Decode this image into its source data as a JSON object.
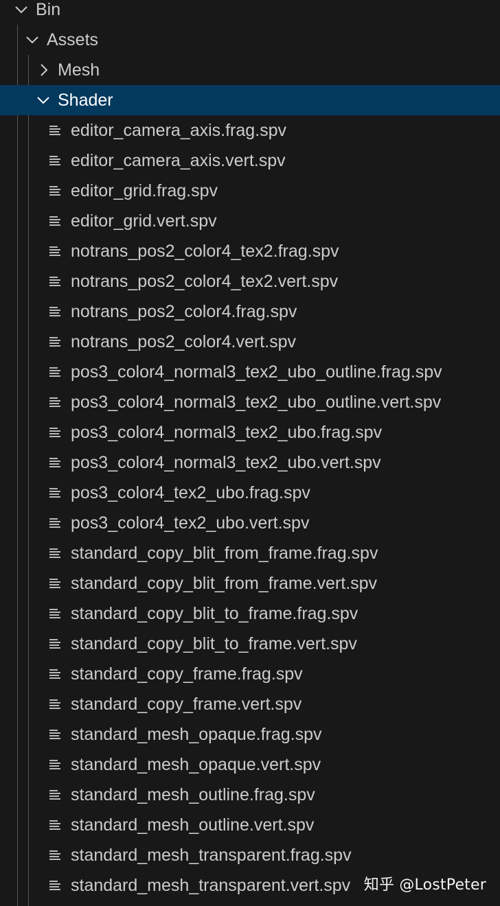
{
  "tree": {
    "root": {
      "label": "Bin",
      "expanded": true,
      "icon": "chevron-down-icon"
    },
    "assets": {
      "label": "Assets",
      "expanded": true,
      "icon": "chevron-down-icon"
    },
    "mesh": {
      "label": "Mesh",
      "expanded": false,
      "icon": "chevron-right-icon"
    },
    "shader": {
      "label": "Shader",
      "expanded": true,
      "selected": true,
      "icon": "chevron-down-icon"
    },
    "files": [
      "editor_camera_axis.frag.spv",
      "editor_camera_axis.vert.spv",
      "editor_grid.frag.spv",
      "editor_grid.vert.spv",
      "notrans_pos2_color4_tex2.frag.spv",
      "notrans_pos2_color4_tex2.vert.spv",
      "notrans_pos2_color4.frag.spv",
      "notrans_pos2_color4.vert.spv",
      "pos3_color4_normal3_tex2_ubo_outline.frag.spv",
      "pos3_color4_normal3_tex2_ubo_outline.vert.spv",
      "pos3_color4_normal3_tex2_ubo.frag.spv",
      "pos3_color4_normal3_tex2_ubo.vert.spv",
      "pos3_color4_tex2_ubo.frag.spv",
      "pos3_color4_tex2_ubo.vert.spv",
      "standard_copy_blit_from_frame.frag.spv",
      "standard_copy_blit_from_frame.vert.spv",
      "standard_copy_blit_to_frame.frag.spv",
      "standard_copy_blit_to_frame.vert.spv",
      "standard_copy_frame.frag.spv",
      "standard_copy_frame.vert.spv",
      "standard_mesh_opaque.frag.spv",
      "standard_mesh_opaque.vert.spv",
      "standard_mesh_outline.frag.spv",
      "standard_mesh_outline.vert.spv",
      "standard_mesh_transparent.frag.spv",
      "standard_mesh_transparent.vert.spv"
    ],
    "file_icon": "text-file-icon"
  },
  "watermark": "知乎 @LostPeter",
  "colors": {
    "background": "#181818",
    "text": "#cccccc",
    "selected_background": "#04395e",
    "selected_text": "#ffffff",
    "indent_guide": "#585858"
  }
}
